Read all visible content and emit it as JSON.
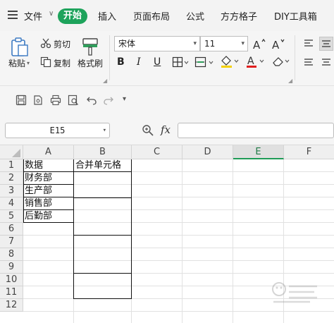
{
  "menubar": {
    "file_label": "文件",
    "tabs": [
      "开始",
      "插入",
      "页面布局",
      "公式",
      "方方格子",
      "DIY工具箱"
    ]
  },
  "ribbon": {
    "paste_label": "粘贴",
    "cut_label": "剪切",
    "copy_label": "复制",
    "format_painter_label": "格式刷",
    "font_name": "宋体",
    "font_size": "11",
    "bold": "B",
    "italic": "I",
    "underline": "U"
  },
  "formula_bar": {
    "name_box": "E15",
    "fx": "fx",
    "formula": ""
  },
  "sheet": {
    "columns": [
      "A",
      "B",
      "C",
      "D",
      "E",
      "F"
    ],
    "active_column": "E",
    "rows": [
      "1",
      "2",
      "3",
      "4",
      "5",
      "6",
      "7",
      "8",
      "9",
      "10",
      "11",
      "12"
    ],
    "cells": {
      "A1": "数据",
      "A2": "财务部",
      "A3": "生产部",
      "A4": "销售部",
      "A5": "后勤部",
      "B1": "合并单元格"
    }
  },
  "colors": {
    "accent": "#1da35b",
    "active_column": "#1f9b57"
  }
}
